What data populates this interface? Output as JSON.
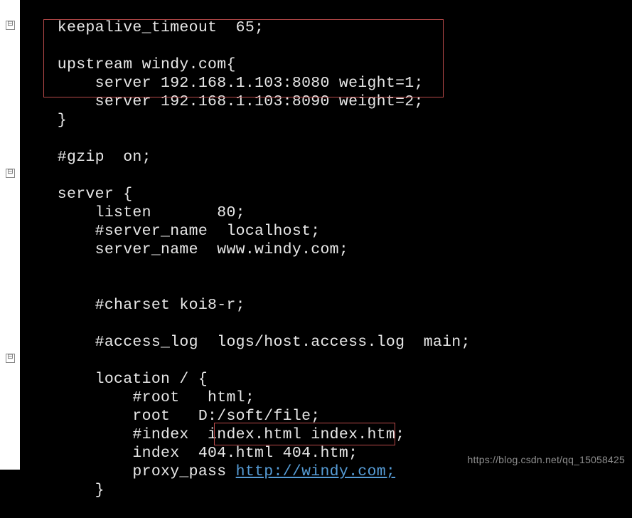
{
  "code": {
    "line1": "    keepalive_timeout  65;",
    "line2": "",
    "line3": "    upstream windy.com{",
    "line4": "        server 192.168.1.103:8080 weight=1;",
    "line5": "        server 192.168.1.103:8090 weight=2;",
    "line6": "    }",
    "line7": "",
    "line8": "    #gzip  on;",
    "line9": "",
    "line10": "    server {",
    "line11": "        listen       80;",
    "line12": "        #server_name  localhost;",
    "line13": "        server_name  www.windy.com;",
    "line14": "",
    "line15": "",
    "line16": "        #charset koi8-r;",
    "line17": "",
    "line18": "        #access_log  logs/host.access.log  main;",
    "line19": "",
    "line20": "        location / {",
    "line21": "            #root   html;",
    "line22": "            root   D:/soft/file;",
    "line23": "            #index  index.html index.htm;",
    "line24": "            index  404.html 404.htm;",
    "line25a": "            proxy_pass ",
    "line25b": "http://windy.com;",
    "line26": "        }"
  },
  "fold_glyph": "⊟",
  "watermark": "https://blog.csdn.net/qq_15058425"
}
